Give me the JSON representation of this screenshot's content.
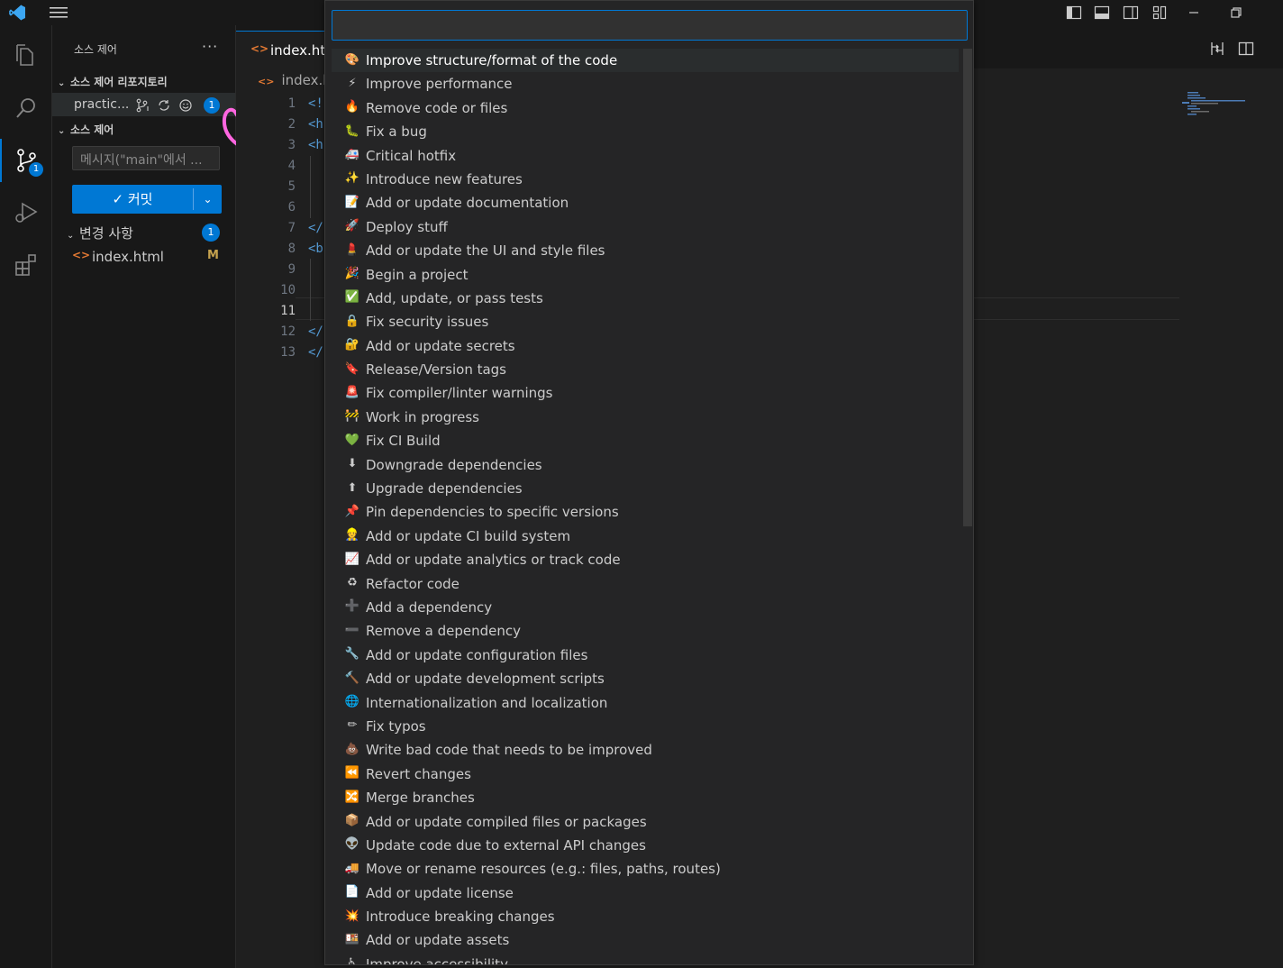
{
  "titlebar": {
    "menu_icon": "menu-icon",
    "layout_icons": [
      "toggle-sidebar-icon",
      "toggle-panel-icon",
      "toggle-secondary-sidebar-icon",
      "customize-layout-icon"
    ],
    "window_controls": [
      "minimize-icon",
      "restore-icon"
    ]
  },
  "activity": {
    "source_control_badge": "1"
  },
  "sidebar": {
    "title": "소스 제어",
    "repos_section": "소스 제어 리포지토리",
    "repo_name": "practic...",
    "repo_badge": "1",
    "scm_section": "소스 제어",
    "message_placeholder": "메시지(\"main\"에서 ...",
    "commit_label": "✓ 커밋",
    "changes_label": "변경 사항",
    "changes_badge": "1",
    "file_name": "index.html",
    "file_status": "M"
  },
  "editor": {
    "tab_label": "index.htm",
    "breadcrumb": "index.ht",
    "line_numbers": [
      "1",
      "2",
      "3",
      "4",
      "5",
      "6",
      "7",
      "8",
      "9",
      "10",
      "11",
      "12",
      "13"
    ],
    "code_lines": [
      "<!",
      "<h",
      "<h",
      "",
      "",
      "",
      "</",
      "<b",
      "",
      "",
      "",
      "</",
      "</"
    ]
  },
  "quickpick": {
    "input_value": "",
    "items": [
      {
        "icon": "🎨",
        "label": "Improve structure/format of the code"
      },
      {
        "icon": "⚡",
        "label": "Improve performance"
      },
      {
        "icon": "🔥",
        "label": "Remove code or files"
      },
      {
        "icon": "🐛",
        "label": "Fix a bug"
      },
      {
        "icon": "🚑",
        "label": "Critical hotfix"
      },
      {
        "icon": "✨",
        "label": "Introduce new features"
      },
      {
        "icon": "📝",
        "label": "Add or update documentation"
      },
      {
        "icon": "🚀",
        "label": "Deploy stuff"
      },
      {
        "icon": "💄",
        "label": "Add or update the UI and style files"
      },
      {
        "icon": "🎉",
        "label": "Begin a project"
      },
      {
        "icon": "✅",
        "label": "Add, update, or pass tests"
      },
      {
        "icon": "🔒",
        "label": "Fix security issues"
      },
      {
        "icon": "🔐",
        "label": "Add or update secrets"
      },
      {
        "icon": "🔖",
        "label": "Release/Version tags"
      },
      {
        "icon": "🚨",
        "label": "Fix compiler/linter warnings"
      },
      {
        "icon": "🚧",
        "label": "Work in progress"
      },
      {
        "icon": "💚",
        "label": "Fix CI Build"
      },
      {
        "icon": "⬇",
        "label": "Downgrade dependencies"
      },
      {
        "icon": "⬆",
        "label": "Upgrade dependencies"
      },
      {
        "icon": "📌",
        "label": "Pin dependencies to specific versions"
      },
      {
        "icon": "👷",
        "label": "Add or update CI build system"
      },
      {
        "icon": "📈",
        "label": "Add or update analytics or track code"
      },
      {
        "icon": "♻",
        "label": "Refactor code"
      },
      {
        "icon": "➕",
        "label": "Add a dependency"
      },
      {
        "icon": "➖",
        "label": "Remove a dependency"
      },
      {
        "icon": "🔧",
        "label": "Add or update configuration files"
      },
      {
        "icon": "🔨",
        "label": "Add or update development scripts"
      },
      {
        "icon": "🌐",
        "label": "Internationalization and localization"
      },
      {
        "icon": "✏",
        "label": "Fix typos"
      },
      {
        "icon": "💩",
        "label": "Write bad code that needs to be improved"
      },
      {
        "icon": "⏪",
        "label": "Revert changes"
      },
      {
        "icon": "🔀",
        "label": "Merge branches"
      },
      {
        "icon": "📦",
        "label": "Add or update compiled files or packages"
      },
      {
        "icon": "👽",
        "label": "Update code due to external API changes"
      },
      {
        "icon": "🚚",
        "label": "Move or rename resources (e.g.: files, paths, routes)"
      },
      {
        "icon": "📄",
        "label": "Add or update license"
      },
      {
        "icon": "💥",
        "label": "Introduce breaking changes"
      },
      {
        "icon": "🍱",
        "label": "Add or update assets"
      },
      {
        "icon": "♿",
        "label": "Improve accessibility"
      }
    ]
  },
  "colors": {
    "accent": "#0078d4",
    "bg": "#1f1f1f",
    "sidebar_bg": "#181818",
    "annotation": "#ff66e0"
  }
}
